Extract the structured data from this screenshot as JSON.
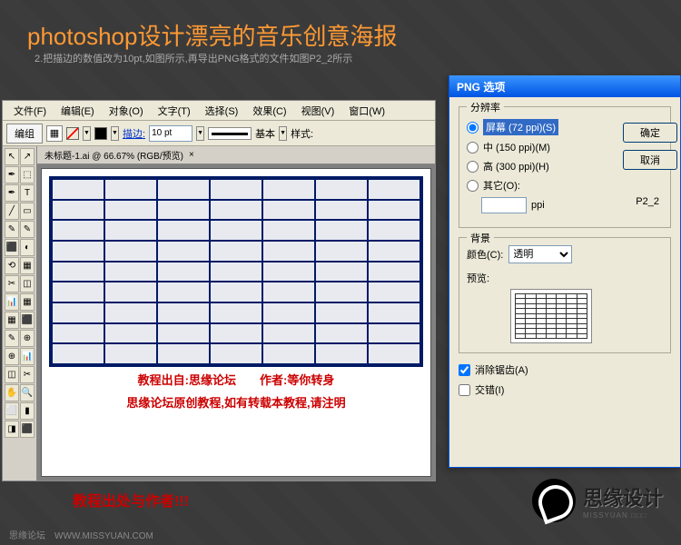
{
  "page": {
    "title": "photoshop设计漂亮的音乐创意海报",
    "subtitle": "2.把描边的数值改为10pt,如图所示,再导出PNG格式的文件如图P2_2所示"
  },
  "menu": {
    "items": [
      "文件(F)",
      "编辑(E)",
      "对象(O)",
      "文字(T)",
      "选择(S)",
      "效果(C)",
      "视图(V)",
      "窗口(W)"
    ]
  },
  "options": {
    "edit_group": "编组",
    "stroke_label": "描边:",
    "stroke_value": "10 pt",
    "basic_label": "基本",
    "style_label": "样式:"
  },
  "doc": {
    "tab_title": "未标题-1.ai @ 66.67% (RGB/预览)",
    "credit1": "教程出自:思缘论坛　　作者:等你转身",
    "credit2": "思缘论坛原创教程,如有转载本教程,请注明"
  },
  "dialog": {
    "title": "PNG 选项",
    "resolution_legend": "分辨率",
    "res_screen": "屏幕 (72 ppi)(S)",
    "res_medium": "中 (150 ppi)(M)",
    "res_high": "高 (300 ppi)(H)",
    "res_other": "其它(O):",
    "ppi_suffix": "ppi",
    "label_p22": "P2_2",
    "bg_legend": "背景",
    "color_label": "颜色(C):",
    "color_value": "透明",
    "preview_label": "预览:",
    "antialias": "消除锯齿(A)",
    "interlaced": "交错(I)",
    "ok": "确定",
    "cancel": "取消"
  },
  "outside": {
    "credit3": "教程出处与作者!!!"
  },
  "logo": {
    "text": "思缘设计",
    "sub": "MISSYUAN □□□"
  },
  "footer": {
    "text": "思缘论坛　WWW.MISSYUAN.COM"
  },
  "tools": [
    "↖",
    "↗",
    "✒",
    "⬚",
    "T",
    "╱",
    "▭",
    "◢",
    "✎",
    "⬛",
    "◐",
    "▦",
    "✂",
    "◫",
    "⟲",
    "📊",
    "⊕",
    "✋",
    "🔍",
    "▮",
    "⬜",
    "◨",
    "⬛",
    "⬜"
  ]
}
